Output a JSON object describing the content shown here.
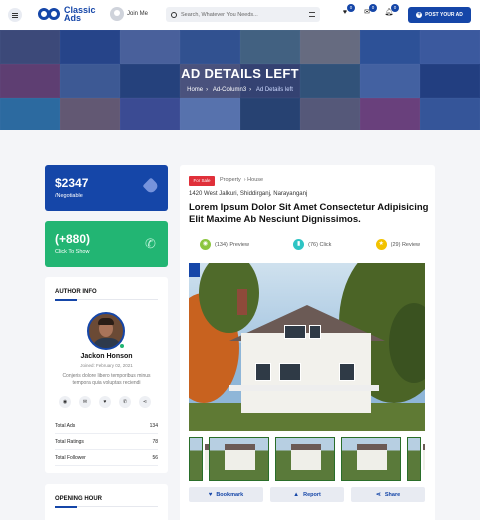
{
  "header": {
    "logo_line1": "Classic",
    "logo_line2": "Ads",
    "join_label": "Join Me",
    "search_placeholder": "Search, Whatever You Needs...",
    "favorites_count": "0",
    "messages_count": "0",
    "notifications_count": "0",
    "post_ad_label": "POST YOUR AD"
  },
  "hero": {
    "title": "AD DETAILS LEFT",
    "breadcrumb": [
      "Home",
      "Ad-Column3",
      "Ad Details left"
    ]
  },
  "sidebar": {
    "price": "$2347",
    "price_note": "/Negotiable",
    "phone": "(+880)",
    "phone_note": "Click To Show",
    "author_heading": "AUTHOR INFO",
    "author_name": "Jackon Honson",
    "author_joined": "Joined: February 02, 2021",
    "author_desc": "Conjeris dolore libero temporibus minus tempora quia voluptas reciendi",
    "stats": [
      {
        "label": "Total Ads",
        "value": "134"
      },
      {
        "label": "Total Ratings",
        "value": "78"
      },
      {
        "label": "Total Follower",
        "value": "56"
      }
    ],
    "hours_heading": "OPENING HOUR"
  },
  "ad": {
    "badge": "For Sale",
    "category": "Property",
    "subcategory": "House",
    "address": "1420 West Jalkuri, Shiddirganj, Narayanganj",
    "title": "Lorem Ipsum Dolor Sit Amet Consectetur Adipisicing Elit Maxime Ab Nesciunt Dignissimos.",
    "metrics": [
      {
        "count": "(134)",
        "label": "Preview",
        "color": "#8cc63f"
      },
      {
        "count": "(76)",
        "label": "Click",
        "color": "#2ec4c4"
      },
      {
        "count": "(29)",
        "label": "Review",
        "color": "#f2c200"
      }
    ],
    "actions": [
      "Bookmark",
      "Report",
      "Share"
    ]
  },
  "colors": {
    "primary": "#1546a8",
    "green": "#22b573",
    "sale_red": "#e0303a"
  }
}
